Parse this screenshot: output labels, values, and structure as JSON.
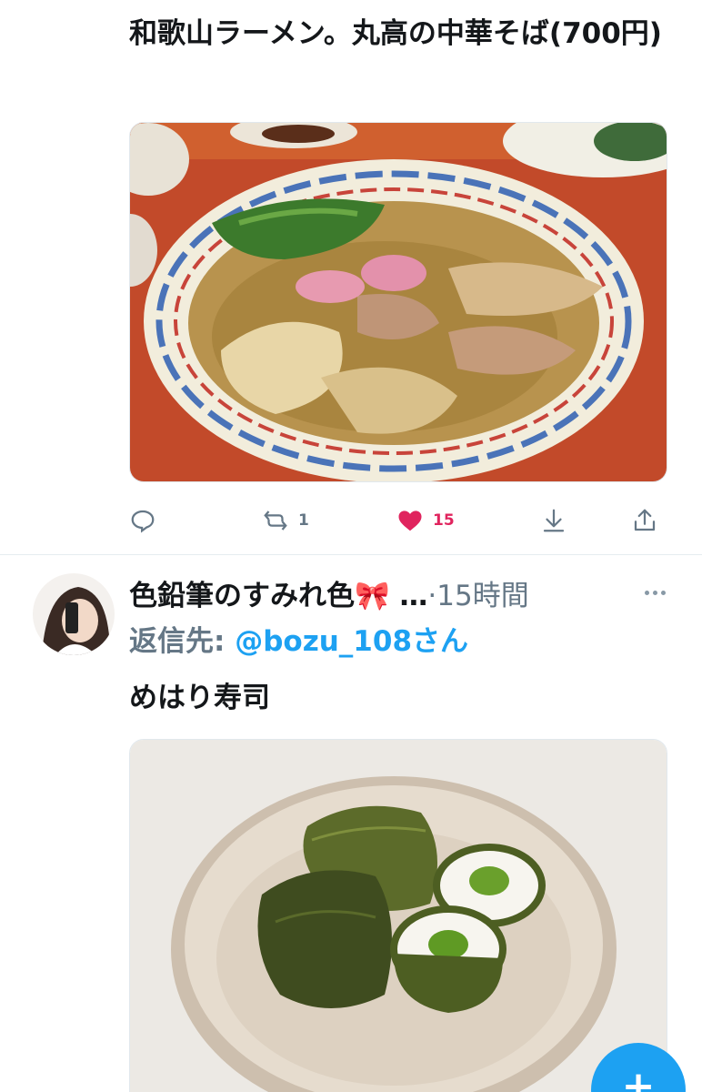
{
  "tweets": [
    {
      "text": "和歌山ラーメン。丸高の中華そば(700円)",
      "media_alt": "ramen-photo",
      "actions": {
        "reply_count": "",
        "retweet_count": "1",
        "like_count": "15",
        "liked": true
      }
    },
    {
      "author_name": "色鉛筆のすみれ色🎀 …",
      "time": "·15時間",
      "reply_label": "返信先:",
      "reply_handle": "@bozu_108さん",
      "text": "めはり寿司",
      "media_alt": "mehari-sushi-photo"
    }
  ],
  "fab": {
    "label": "+"
  },
  "colors": {
    "accent": "#1da1f2",
    "like": "#e0245e",
    "muted": "#657786"
  }
}
